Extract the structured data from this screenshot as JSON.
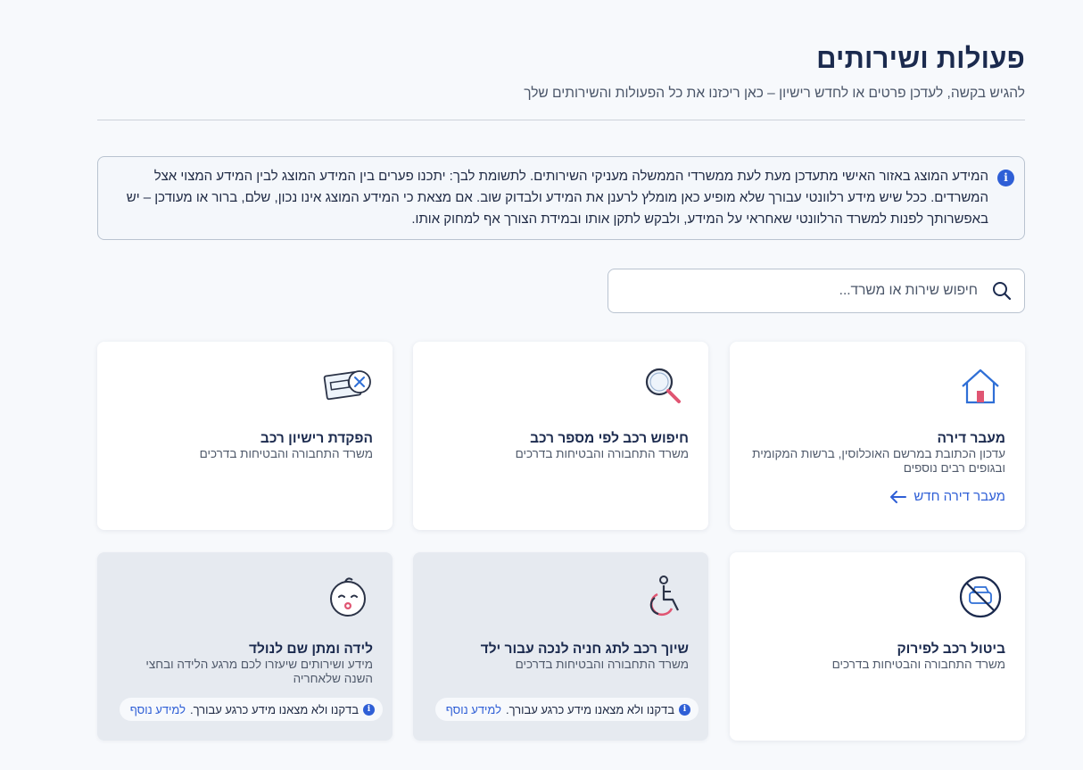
{
  "header": {
    "title": "פעולות ושירותים",
    "subtitle": "להגיש בקשה, לעדכן פרטים או לחדש רישיון – כאן ריכזנו את כל הפעולות והשירותים שלך"
  },
  "notice": {
    "icon": "info-icon",
    "text": "המידע המוצג באזור האישי מתעדכן מעת לעת ממשרדי הממשלה מעניקי השירותים. לתשומת לבך: יתכנו פערים בין המידע המוצג לבין המידע המצוי אצל המשרדים. ככל שיש מידע רלוונטי עבורך שלא מופיע כאן מומלץ לרענן את המידע ולבדוק שוב. אם מצאת כי המידע המוצג אינו נכון, שלם, ברור או מעודכן – יש באפשרותך לפנות למשרד הרלוונטי שאחראי על המידע, ולבקש לתקן אותו ובמידת הצורך אף למחוק אותו."
  },
  "search": {
    "placeholder": "חיפוש שירות או משרד...",
    "icon": "search-icon"
  },
  "cards": [
    {
      "icon": "house-icon",
      "title": "מעבר דירה",
      "description": "עדכון הכתובת במרשם האוכלוסין, ברשות המקומית ובגופים רבים נוספים",
      "link": "מעבר דירה חדש",
      "disabled": false
    },
    {
      "icon": "magnifier-icon",
      "title": "חיפוש רכב לפי מספר רכב",
      "description": "משרד התחבורה והבטיחות בדרכים",
      "disabled": false
    },
    {
      "icon": "license-cancel-icon",
      "title": "הפקדת רישיון רכב",
      "description": "משרד התחבורה והבטיחות בדרכים",
      "disabled": false
    },
    {
      "icon": "no-car-icon",
      "title": "ביטול רכב לפירוק",
      "description": "משרד התחבורה והבטיחות בדרכים",
      "disabled": false
    },
    {
      "icon": "wheelchair-icon",
      "title": "שיוך רכב לתג חניה לנכה עבור ילד",
      "description": "משרד התחבורה והבטיחות בדרכים",
      "disabled": true,
      "status": "בדקנו ולא מצאנו מידע כרגע עבורך.",
      "status_link": "למידע נוסף"
    },
    {
      "icon": "baby-icon",
      "title": "לידה ומתן שם לנולד",
      "description": "מידע ושירותים שיעזרו לכם מרגע הלידה ובחצי השנה שלאחריה",
      "disabled": true,
      "status": "בדקנו ולא מצאנו מידע כרגע עבורך.",
      "status_link": "למידע נוסף"
    }
  ],
  "colors": {
    "accent": "#2f5fd6",
    "title": "#1b2a4e",
    "background": "#f7f9fc",
    "disabled_card": "#e6eaf0"
  }
}
